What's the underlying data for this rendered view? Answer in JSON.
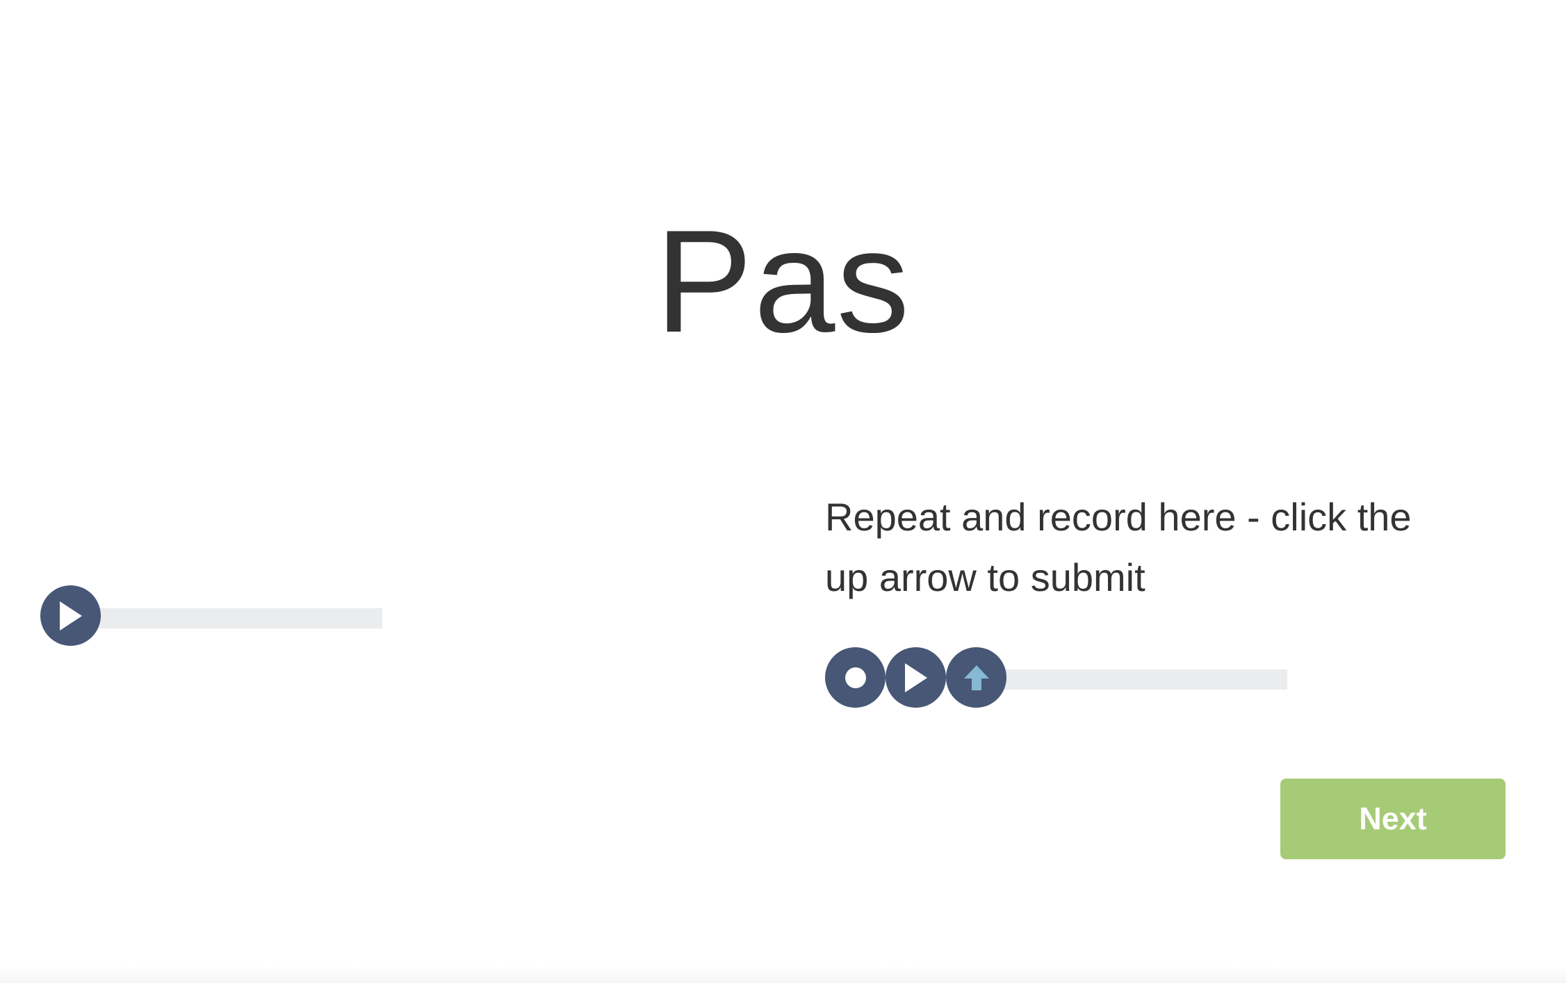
{
  "word": "Pas",
  "source_player": {
    "play_icon": "play-icon",
    "progress": 0
  },
  "recorder": {
    "instruction": "Repeat and record here - click the up arrow to submit",
    "record_icon": "record-icon",
    "play_icon": "play-icon",
    "submit_icon": "up-arrow-icon",
    "progress": 0
  },
  "next_label": "Next",
  "colors": {
    "button": "#475775",
    "track": "#ebecee",
    "upload_arrow": "#86b9d3",
    "next": "#a6cb76",
    "text": "#333333"
  }
}
